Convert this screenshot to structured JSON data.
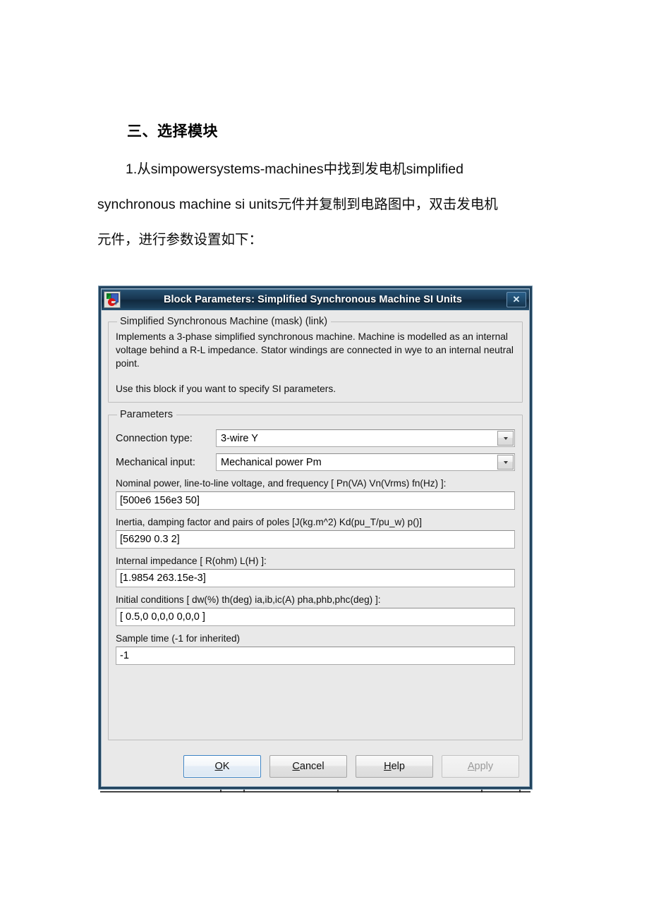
{
  "document": {
    "heading": "三、选择模块",
    "paragraph_line1": "1.从simpowersystems-machines中找到发电机simplified",
    "paragraph_line2": "synchronous machine si units元件并复制到电路图中，双击发电机",
    "paragraph_line3": "元件，进行参数设置如下："
  },
  "dialog": {
    "title": "Block Parameters: Simplified Synchronous Machine SI Units",
    "close_label": "✕",
    "description_group": {
      "legend": "Simplified Synchronous Machine (mask) (link)",
      "paragraph1": "Implements a 3-phase simplified synchronous machine. Machine is modelled as an internal voltage behind a R-L impedance. Stator windings are connected in wye to an internal neutral point.",
      "paragraph2": "Use this block if you want to specify SI  parameters."
    },
    "parameters_group": {
      "legend": "Parameters",
      "connection_type": {
        "label": "Connection type:",
        "value": "3-wire Y"
      },
      "mechanical_input": {
        "label": "Mechanical input:",
        "value": "Mechanical power Pm"
      },
      "nominal": {
        "label": "Nominal power, line-to-line voltage, and frequency [ Pn(VA) Vn(Vrms) fn(Hz) ]:",
        "value": "[500e6 156e3 50]"
      },
      "inertia": {
        "label": "Inertia, damping factor and pairs of poles [J(kg.m^2) Kd(pu_T/pu_w) p()]",
        "value": "[56290 0.3 2]"
      },
      "impedance": {
        "label": "Internal impedance [ R(ohm)  L(H) ]:",
        "value": "[1.9854  263.15e-3]"
      },
      "initial_conditions": {
        "label": "Initial conditions [ dw(%)  th(deg)  ia,ib,ic(A)  pha,phb,phc(deg) ]:",
        "value": "[ 0.5,0   0,0,0   0,0,0 ]"
      },
      "sample_time": {
        "label": "Sample time (-1 for inherited)",
        "value": "-1"
      }
    },
    "buttons": {
      "ok": {
        "mnemonic": "O",
        "rest": "K"
      },
      "cancel": {
        "mnemonic": "C",
        "rest": "ancel"
      },
      "help": {
        "mnemonic": "H",
        "rest": "elp"
      },
      "apply": {
        "mnemonic": "A",
        "rest": "pply"
      }
    }
  },
  "colors": {
    "titlebar_dark": "#17344e",
    "dialog_border": "#22445f",
    "dialog_bg": "#e9e9e9",
    "focus_blue": "#3c83c4"
  }
}
